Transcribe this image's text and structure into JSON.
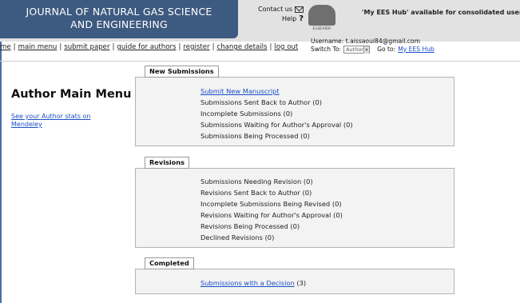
{
  "header": {
    "journal_title_line1": "JOURNAL OF NATURAL GAS SCIENCE",
    "journal_title_line2": "AND ENGINEERING",
    "contact_label": "Contact us",
    "help_label": "Help",
    "help_symbol": "?",
    "publisher_logo_text": "ELSEVIER",
    "ees_hub_text": "'My EES Hub' available for consolidated users ...",
    "ees_hub_link": "n"
  },
  "user": {
    "username_label": "Username:",
    "username_value": "t.aissaoui84@gmail.com",
    "switch_label": "Switch To:",
    "switch_value": "Author",
    "goto_label": "Go to:",
    "goto_link": "My EES Hub"
  },
  "nav": {
    "items": [
      "me",
      "main menu",
      "submit paper",
      "guide for authors",
      "register",
      "change details",
      "log out"
    ]
  },
  "left": {
    "title": "Author Main Menu",
    "stats_link": "See your Author stats on Mendeley"
  },
  "new_submissions": {
    "tab": "New Submissions",
    "items": [
      "Submit New Manuscript",
      "Submissions Sent Back to Author (0)",
      "Incomplete Submissions (0)",
      "Submissions Waiting for Author's Approval (0)",
      "Submissions Being Processed (0)"
    ]
  },
  "revisions": {
    "tab": "Revisions",
    "items": [
      "Submissions Needing Revision (0)",
      "Revisions Sent Back to Author (0)",
      "Incomplete Submissions Being Revised (0)",
      "Revisions Waiting for Author's Approval (0)",
      "Revisions Being Processed (0)",
      "Declined Revisions (0)"
    ]
  },
  "completed": {
    "tab": "Completed",
    "link": "Submissions with a Decision",
    "count": "(3)"
  },
  "colors": {
    "banner": "#3d5a80",
    "link": "#1a4fc7",
    "header_bg": "#e2e2e2",
    "section_bg": "#f3f3f3"
  },
  "icons": [
    "mail-icon",
    "elsevier-logo"
  ]
}
